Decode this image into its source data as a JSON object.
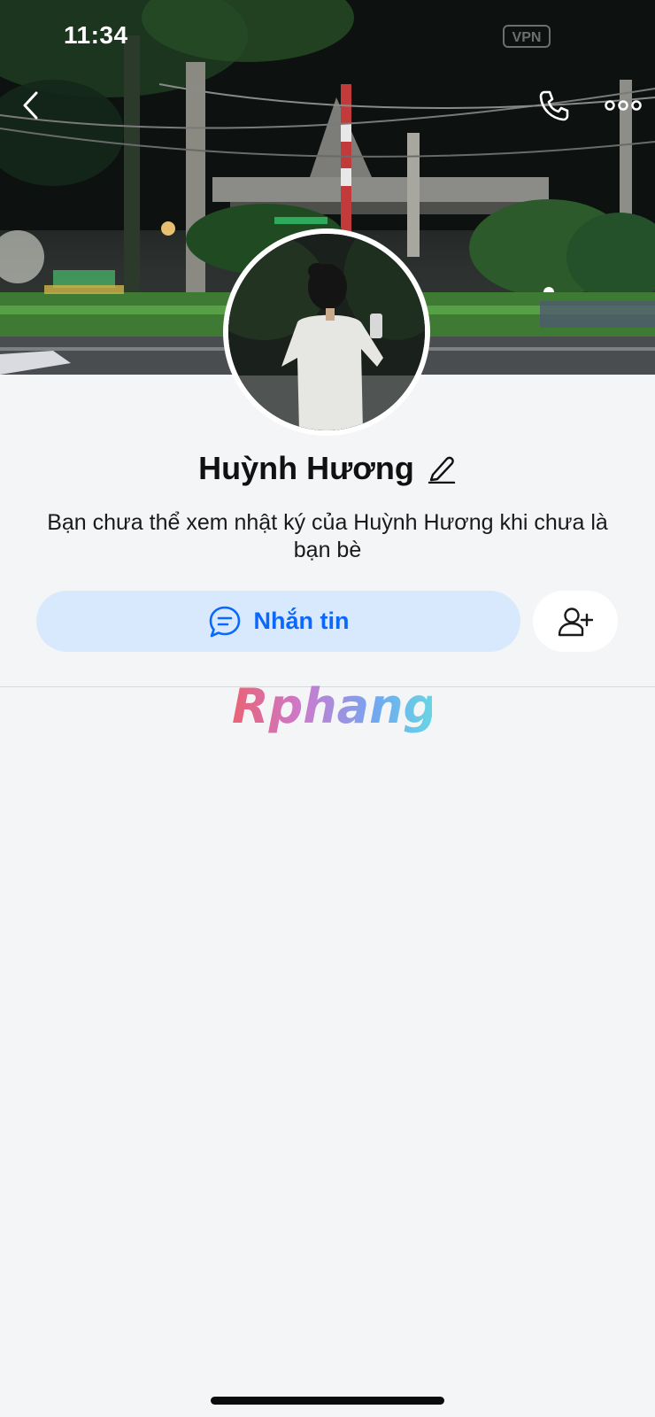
{
  "status_bar": {
    "time": "11:34",
    "vpn": "VPN"
  },
  "top_nav": {
    "back_icon": "chevron-left-icon",
    "call_icon": "phone-icon",
    "more_icon": "more-dots-icon"
  },
  "profile": {
    "name": "Huỳnh Hương",
    "edit_icon": "pencil-icon",
    "description": "Bạn chưa thể xem nhật ký của Huỳnh Hương khi chưa là bạn bè"
  },
  "actions": {
    "message_label": "Nhắn tin",
    "message_icon": "chat-bubble-icon",
    "add_friend_icon": "add-friend-icon"
  },
  "watermark": {
    "text": "Rphang"
  },
  "colors": {
    "accent": "#0a68ff",
    "message_button_bg": "#d9e9fd",
    "page_bg": "#f4f5f7"
  }
}
